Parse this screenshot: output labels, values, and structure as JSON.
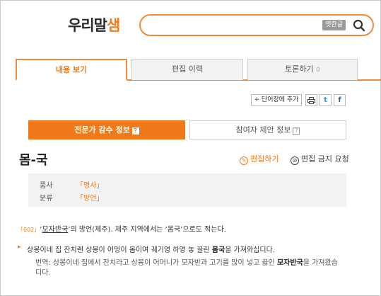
{
  "logo": {
    "text": "우리말",
    "accent": "샘"
  },
  "search": {
    "value": "",
    "old_char_button": "옛한글"
  },
  "tabs": [
    {
      "label": "내용 보기"
    },
    {
      "label": "편집 이력"
    },
    {
      "label": "토론하기",
      "count": "0"
    }
  ],
  "toolbar": {
    "add_vocab": "+ 단어장에 추가",
    "twitter": "t",
    "facebook": "f"
  },
  "subtabs": {
    "expert": "전문가 감수 정보",
    "participant": "참여자 제안 정보",
    "help_mark": "?"
  },
  "entry": {
    "headword": "몸-국",
    "edit_label": "편집하기",
    "ban_label": "편집 금지 요청",
    "pos_label": "품사",
    "pos_value": "「명사」",
    "category_label": "분류",
    "category_value": "「방언」",
    "sense_no": "「002」",
    "def_quote_open": "‘",
    "def_keyword": "모자반국",
    "def_rest": "’의 방언(제주). 제주 지역에서는 ‘몸국’으로도 적는다.",
    "example_pre": "상봉이네 집 잔치렌 상봉이 어멍이 몸이여 궤기영 하영 놓 끌린 ",
    "example_bold": "몸국",
    "example_post": "을 가져와십디다.",
    "translation_pre": "번역: 상봉이네 집에서 잔치라고 상봉이 어머니가 모자반과 고기를 많이 넣고 끓인 ",
    "translation_bold": "모자반국",
    "translation_post": "을 가져왔습",
    "translation_line2": "디다."
  },
  "colors": {
    "accent": "#f07a1a",
    "tab_border": "#f08a3c"
  }
}
